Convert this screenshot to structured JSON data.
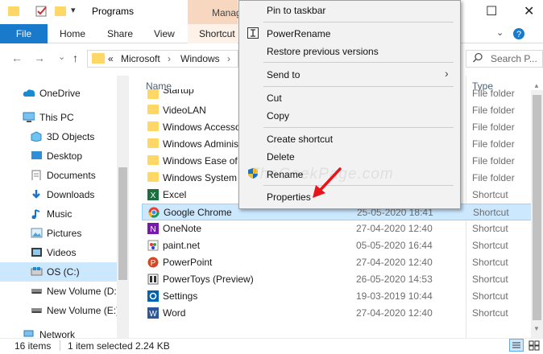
{
  "window": {
    "title": "Programs",
    "manage_tab": "Manage",
    "minimize": "—",
    "maximize": "☐",
    "close": "✕"
  },
  "ribbon": {
    "file": "File",
    "home": "Home",
    "share": "Share",
    "view": "View",
    "shortcut_tools": "Shortcut Tools",
    "collapse": "⌄",
    "help": "?"
  },
  "address": {
    "back": "←",
    "forward": "→",
    "recent": "⌄",
    "up": "↑",
    "crumbs": [
      "«",
      "Microsoft",
      "›",
      "Windows",
      "›"
    ],
    "refresh": "↻",
    "search_placeholder": "Search P..."
  },
  "nav": {
    "items": [
      {
        "label": "OneDrive",
        "icon": "cloud-icon"
      },
      {
        "label": "This PC",
        "icon": "pc-icon"
      },
      {
        "label": "3D Objects",
        "icon": "cube-icon"
      },
      {
        "label": "Desktop",
        "icon": "desktop-icon"
      },
      {
        "label": "Documents",
        "icon": "document-icon"
      },
      {
        "label": "Downloads",
        "icon": "download-icon"
      },
      {
        "label": "Music",
        "icon": "music-icon"
      },
      {
        "label": "Pictures",
        "icon": "picture-icon"
      },
      {
        "label": "Videos",
        "icon": "video-icon"
      },
      {
        "label": "OS (C:)",
        "icon": "windows-drive-icon"
      },
      {
        "label": "New Volume (D:)",
        "icon": "drive-icon"
      },
      {
        "label": "New Volume (E:)",
        "icon": "drive-icon"
      },
      {
        "label": "Network",
        "icon": "network-icon"
      }
    ]
  },
  "columns": {
    "name": "Name",
    "type": "Type"
  },
  "files": [
    {
      "name": "Startup",
      "date": "",
      "type": "File folder",
      "icon": "folder-icon"
    },
    {
      "name": "VideoLAN",
      "date": "",
      "type": "File folder",
      "icon": "folder-icon"
    },
    {
      "name": "Windows Accessories",
      "date": "",
      "type": "File folder",
      "icon": "folder-icon"
    },
    {
      "name": "Windows Administrative Tools",
      "date": "",
      "type": "File folder",
      "icon": "folder-icon"
    },
    {
      "name": "Windows Ease of Access",
      "date": "",
      "type": "File folder",
      "icon": "folder-icon"
    },
    {
      "name": "Windows System",
      "date": "",
      "type": "File folder",
      "icon": "folder-icon"
    },
    {
      "name": "Excel",
      "date": "",
      "type": "Shortcut",
      "icon": "excel-icon"
    },
    {
      "name": "Google Chrome",
      "date": "25-05-2020 18:41",
      "type": "Shortcut",
      "icon": "chrome-icon"
    },
    {
      "name": "OneNote",
      "date": "27-04-2020 12:40",
      "type": "Shortcut",
      "icon": "onenote-icon"
    },
    {
      "name": "paint.net",
      "date": "05-05-2020 16:44",
      "type": "Shortcut",
      "icon": "paintnet-icon"
    },
    {
      "name": "PowerPoint",
      "date": "27-04-2020 12:40",
      "type": "Shortcut",
      "icon": "powerpoint-icon"
    },
    {
      "name": "PowerToys (Preview)",
      "date": "26-05-2020 14:53",
      "type": "Shortcut",
      "icon": "powertoys-icon"
    },
    {
      "name": "Settings",
      "date": "19-03-2019 10:44",
      "type": "Shortcut",
      "icon": "settings-icon"
    },
    {
      "name": "Word",
      "date": "27-04-2020 12:40",
      "type": "Shortcut",
      "icon": "word-icon"
    }
  ],
  "context_menu": {
    "pin_taskbar": "Pin to taskbar",
    "power_rename": "PowerRename",
    "restore_versions": "Restore previous versions",
    "send_to": "Send to",
    "cut": "Cut",
    "copy": "Copy",
    "create_shortcut": "Create shortcut",
    "delete": "Delete",
    "rename": "Rename",
    "properties": "Properties"
  },
  "watermark": "TheGeekPage.com",
  "status": {
    "count": "16 items",
    "selected": "1 item selected",
    "size": "2.24 KB"
  },
  "colors": {
    "accent": "#1979ca",
    "selection": "#cce8ff",
    "manage": "#f7d7bf",
    "arrow": "#e8141b"
  }
}
